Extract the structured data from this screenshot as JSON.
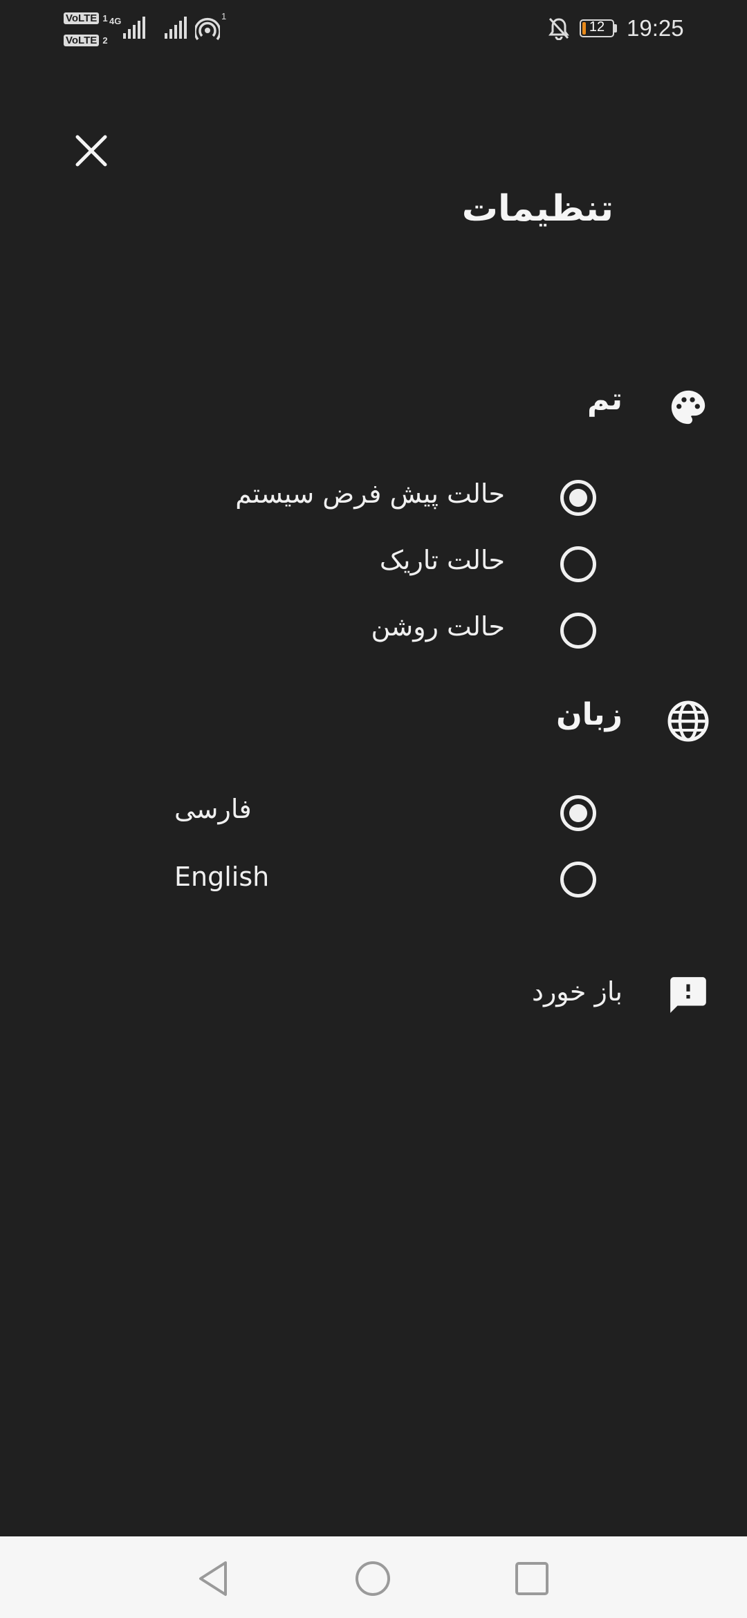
{
  "status_bar": {
    "sim1_label": "VoLTE",
    "sim1_num": "1",
    "sim2_label": "VoLTE",
    "sim2_num": "2",
    "network_type": "4G",
    "hotspot_count": "1",
    "battery_level": "12",
    "battery_fraction": 0.12,
    "time": "19:25",
    "icons": [
      "signal-icon",
      "hotspot-icon",
      "notifications-off-icon",
      "battery-icon"
    ]
  },
  "header": {
    "close_icon": "close-icon",
    "title": "تنظیمات"
  },
  "theme_section": {
    "icon": "palette-icon",
    "title": "تم",
    "options": [
      {
        "label": "حالت پیش فرض سیستم",
        "selected": true
      },
      {
        "label": "حالت تاریک",
        "selected": false
      },
      {
        "label": "حالت روشن",
        "selected": false
      }
    ]
  },
  "language_section": {
    "icon": "globe-icon",
    "title": "زبان",
    "options": [
      {
        "label": "فارسی",
        "selected": true
      },
      {
        "label": "English",
        "selected": false
      }
    ]
  },
  "feedback": {
    "icon": "feedback-icon",
    "label": "باز خورد"
  },
  "navigation_bar": {
    "icons": [
      "back-icon",
      "home-icon",
      "recents-icon"
    ]
  },
  "colors": {
    "background": "#202020",
    "text": "#f0f0f0",
    "navigation_bar": "#f6f6f6",
    "battery_low": "#e88a1a"
  }
}
